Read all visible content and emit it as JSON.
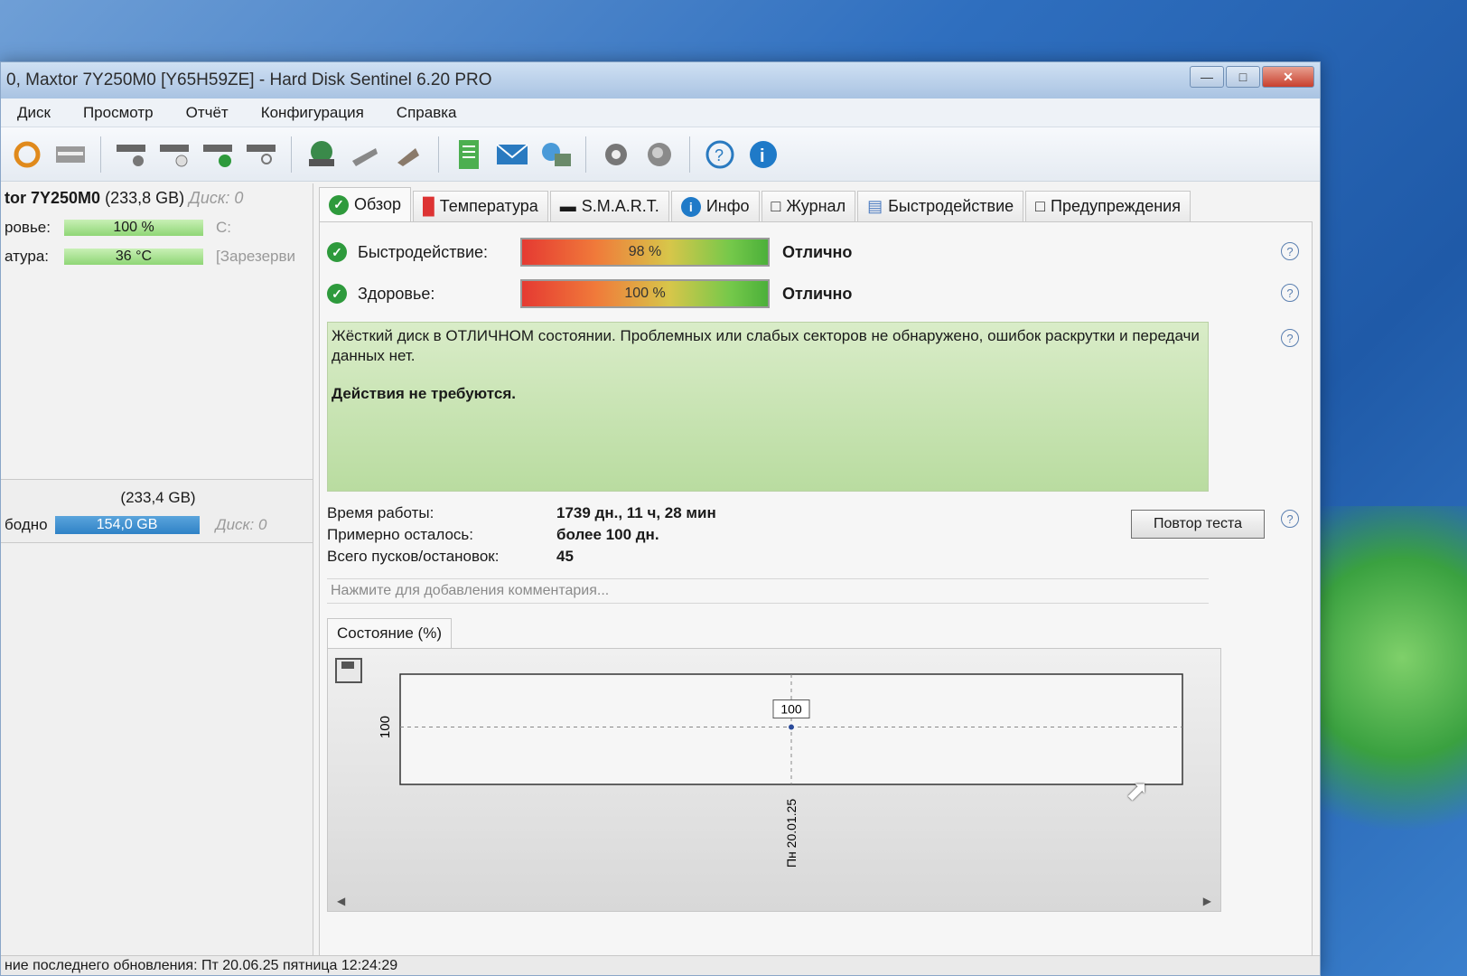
{
  "window": {
    "title": "0, Maxtor 7Y250M0 [Y65H59ZE]  -  Hard Disk Sentinel 6.20 PRO"
  },
  "menu": [
    "Диск",
    "Просмотр",
    "Отчёт",
    "Конфигурация",
    "Справка"
  ],
  "toolbar_icons": [
    "refresh-icon",
    "drive-icon",
    "disk-tools-icon",
    "disk-schedule-icon",
    "disk-ok-icon",
    "disk-search-icon",
    "network-disk-icon",
    "eject-icon",
    "usb-disk-icon",
    "report-icon",
    "email-icon",
    "network-icon",
    "settings-icon",
    "sound-icon",
    "help-icon",
    "info-icon"
  ],
  "left_panel": {
    "disk_title": "tor 7Y250M0",
    "disk_size": "(233,8 GB)",
    "disk_label": "Диск: 0",
    "health_label": "ровье:",
    "health_value": "100 %",
    "health_drive": "C:",
    "temp_label": "атура:",
    "temp_value": "36 °C",
    "temp_note": "[Зарезерви",
    "partition_size": "(233,4 GB)",
    "free_label": "бодно",
    "free_value": "154,0 GB",
    "free_disk": "Диск: 0"
  },
  "tabs": [
    {
      "label": "Обзор",
      "icon": "ok-icon",
      "active": true
    },
    {
      "label": "Температура",
      "icon": "thermometer-icon"
    },
    {
      "label": "S.M.A.R.T.",
      "icon": "smart-icon"
    },
    {
      "label": "Инфо",
      "icon": "info-icon"
    },
    {
      "label": "Журнал",
      "icon": "log-icon"
    },
    {
      "label": "Быстродействие",
      "icon": "performance-icon"
    },
    {
      "label": "Предупреждения",
      "icon": "warning-icon"
    }
  ],
  "overview": {
    "performance_label": "Быстродействие:",
    "performance_value": "98 %",
    "performance_percent": 98,
    "performance_rating": "Отлично",
    "health_label": "Здоровье:",
    "health_value": "100 %",
    "health_percent": 100,
    "health_rating": "Отлично",
    "status_text": "Жёсткий диск в ОТЛИЧНОМ состоянии. Проблемных или слабых секторов не обнаружено, ошибок раскрутки и передачи данных нет.",
    "action_text": "Действия не требуются.",
    "uptime_label": "Время работы:",
    "uptime_value": "1739 дн., 11 ч, 28 мин",
    "remaining_label": "Примерно осталось:",
    "remaining_value": "более 100 дн.",
    "starts_label": "Всего пусков/остановок:",
    "starts_value": "45",
    "retest_button": "Повтор теста",
    "comment_placeholder": "Нажмите для добавления комментария..."
  },
  "chart_tab": "Состояние (%)",
  "chart_data": {
    "type": "line",
    "x": [
      "Пн 20.01.25"
    ],
    "series": [
      {
        "values": [
          100
        ]
      }
    ],
    "ytick": "100",
    "data_label": "100"
  },
  "statusbar": "ние последнего обновления: Пт 20.06.25 пятница 12:24:29"
}
